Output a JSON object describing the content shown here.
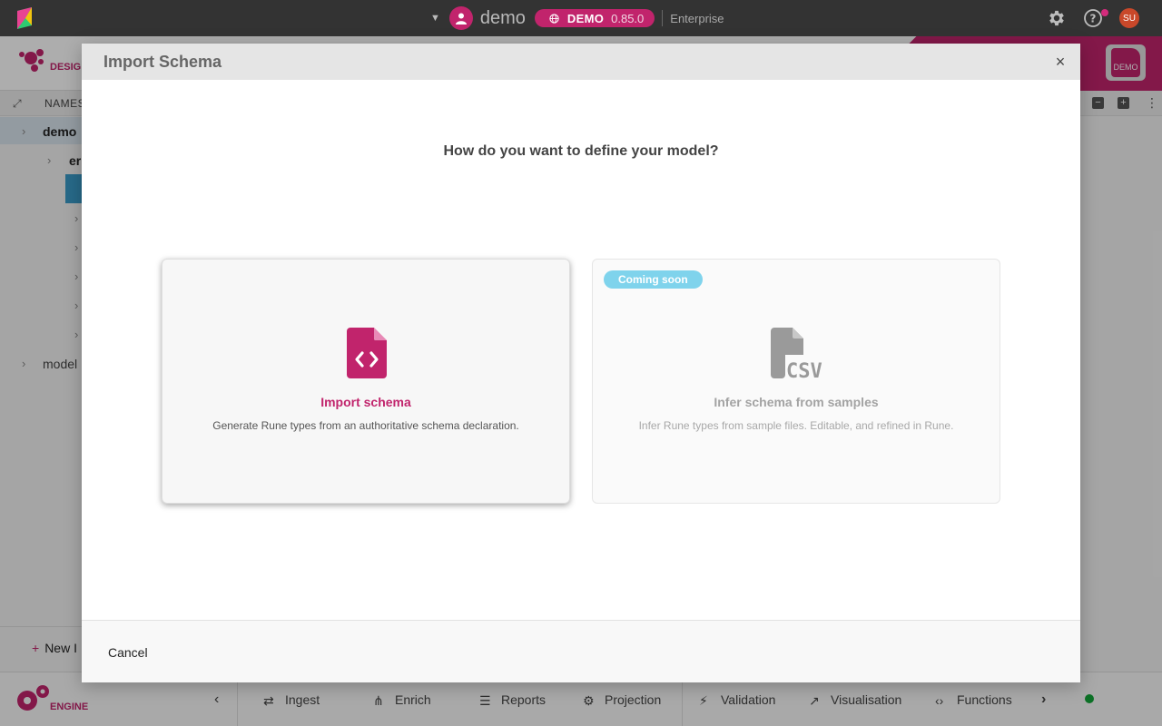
{
  "topbar": {
    "project": "demo",
    "environment": "DEMO",
    "version": "0.85.0",
    "edition": "Enterprise",
    "user_initials": "SU",
    "accent_color": "#c1246c"
  },
  "app": {
    "design_label": "DESIG",
    "demo_badge": "DEMO",
    "names_label": "NAMES",
    "tree": {
      "root": "demo",
      "child": "er",
      "model": "model"
    },
    "new_label": "New I",
    "engine_label": "ENGINE",
    "bottom_nav": [
      "Ingest",
      "Enrich",
      "Reports",
      "Projection",
      "Validation",
      "Visualisation",
      "Functions"
    ]
  },
  "modal": {
    "title": "Import Schema",
    "question": "How do you want to define your model?",
    "options": [
      {
        "title": "Import schema",
        "description": "Generate Rune types from an authoritative schema declaration.",
        "icon": "file-code-icon"
      },
      {
        "badge": "Coming soon",
        "title": "Infer schema from samples",
        "description": "Infer Rune types from sample files. Editable, and refined in Rune.",
        "icon": "file-csv-icon",
        "csv_label": "CSV"
      }
    ],
    "cancel_label": "Cancel"
  }
}
